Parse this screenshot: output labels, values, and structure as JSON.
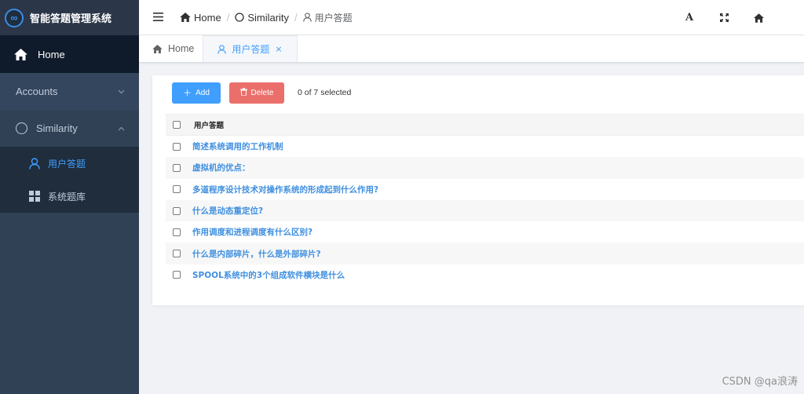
{
  "app": {
    "title": "智能答题管理系统",
    "logo_glyph": "∞"
  },
  "sidebar": {
    "home": {
      "label": "Home",
      "icon": "home-icon"
    },
    "accounts": {
      "label": "Accounts",
      "icon": "chevron-down-icon"
    },
    "similarity": {
      "label": "Similarity",
      "icon": "circle-icon"
    },
    "sub_items": [
      {
        "label": "用户答题",
        "icon": "user-icon",
        "active": true
      },
      {
        "label": "系统题库",
        "icon": "grid-icon",
        "active": false
      }
    ]
  },
  "navbar": {
    "breadcrumb": [
      {
        "label": "Home",
        "icon": "home-icon"
      },
      {
        "label": "Similarity",
        "icon": "circle-icon"
      },
      {
        "label": "用户答题",
        "icon": "user-icon"
      }
    ],
    "separator": "/",
    "right_icons": [
      "font-size-icon",
      "fullscreen-icon",
      "home-icon"
    ],
    "font_glyph": "A"
  },
  "tags": [
    {
      "label": "Home",
      "icon": "home-icon",
      "active": false
    },
    {
      "label": "用户答题",
      "icon": "user-icon",
      "active": true,
      "close": "×"
    }
  ],
  "toolbar": {
    "add_label": "Add",
    "delete_label": "Delete",
    "selected_text": "0 of 7 selected"
  },
  "table": {
    "header": "用户答题",
    "rows": [
      "简述系统调用的工作机制",
      "虚拟机的优点：",
      "多道程序设计技术对操作系统的形成起到什么作用?",
      "什么是动态重定位?",
      "作用调度和进程调度有什么区别?",
      "什么是内部碎片，什么是外部碎片?",
      "SPOOL系统中的3个组成软件横块是什么"
    ]
  },
  "watermark": "CSDN @qa浪涛",
  "colors": {
    "sidebar": "#304156",
    "accent": "#409eff",
    "danger": "#ea6f6b"
  }
}
